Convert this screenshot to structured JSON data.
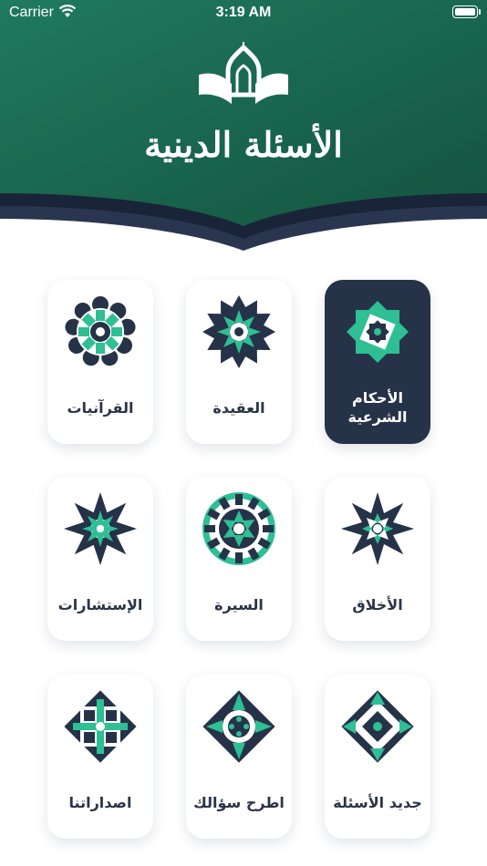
{
  "status": {
    "carrier": "Carrier",
    "time": "3:19 AM"
  },
  "app": {
    "title": "الأسئلة الدينية"
  },
  "colors": {
    "header_green": "#1b6e55",
    "navy": "#263248",
    "teal": "#2ebf94"
  },
  "categories": [
    {
      "label": "الأحكام الشرعية",
      "icon": "star-medallion-icon",
      "active": true
    },
    {
      "label": "العقيدة",
      "icon": "rosette-icon",
      "active": false
    },
    {
      "label": "القرآنيات",
      "icon": "flower-medallion-icon",
      "active": false
    },
    {
      "label": "الأخلاق",
      "icon": "starburst-icon",
      "active": false
    },
    {
      "label": "السيرة",
      "icon": "circle-medallion-icon",
      "active": false
    },
    {
      "label": "الإستشارات",
      "icon": "eight-point-star-icon",
      "active": false
    },
    {
      "label": "جديد الأسئلة",
      "icon": "diamond-arabesque-icon",
      "active": false
    },
    {
      "label": "اطرح سؤالك",
      "icon": "diamond-medallion-icon",
      "active": false
    },
    {
      "label": "اصداراتنا",
      "icon": "square-arabesque-icon",
      "active": false
    }
  ]
}
